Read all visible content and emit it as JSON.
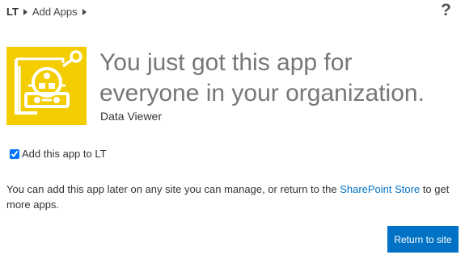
{
  "breadcrumb": {
    "site": "LT",
    "page": "Add Apps"
  },
  "help": {
    "label": "?"
  },
  "app": {
    "headline": "You just got this app for everyone in your organization.",
    "name": "Data Viewer",
    "tile_color": "#f4cd00",
    "icon": "data-viewer-robot-icon"
  },
  "add_option": {
    "checked": true,
    "label": "Add this app to LT"
  },
  "info": {
    "text_before": "You can add this app later on any site you can manage, or return to the ",
    "link_text": "SharePoint Store",
    "text_after": " to get more apps."
  },
  "actions": {
    "return_label": "Return to site",
    "accent": "#0072c6"
  }
}
